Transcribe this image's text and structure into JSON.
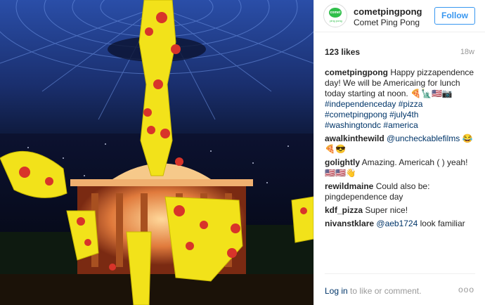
{
  "post": {
    "image_alt": "Pizza beam from alien ship over the White House",
    "header": {
      "username": "cometpingpong",
      "full_name": "Comet Ping Pong",
      "follow_label": "Follow",
      "avatar_logo_text": "comet",
      "avatar_logo_sub": "ping pong"
    },
    "likes": "123 likes",
    "age": "18w",
    "comments": [
      {
        "user": "cometpingpong",
        "text": " Happy pizzapendence day! We will be Americaing for lunch today starting at noon. 🍕🗽🇺🇸📷",
        "hashtags": " #independenceday #pizza #cometpingpong #july4th #washingtondc #america"
      },
      {
        "user": "awalkinthewild",
        "mention": " @uncheckablefilms",
        "text": " 😂🍕😎"
      },
      {
        "user": "golightly",
        "text": " Amazing. Americah ( ) yeah! 🇺🇸🇺🇸👋"
      },
      {
        "user": "rewildmaine",
        "text": " Could also be: pingdependence day"
      },
      {
        "user": "kdf_pizza",
        "text": " Super nice!"
      },
      {
        "user": "nivanstklare",
        "mention": " @aeb1724",
        "text": " look familiar"
      }
    ],
    "footer": {
      "login_link": "Log in",
      "login_rest": " to like or comment.",
      "more_label": "ooo"
    }
  },
  "colors": {
    "accent": "#3897f0",
    "link": "#003569",
    "muted": "#999999",
    "pizza_yellow": "#f2e21a",
    "pepperoni": "#d8342a",
    "sky": "#1f3f8f"
  }
}
